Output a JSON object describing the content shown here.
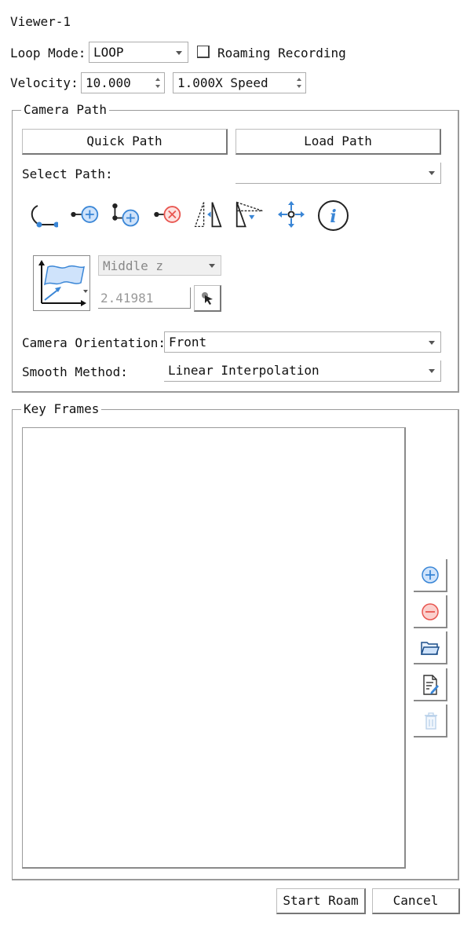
{
  "window": {
    "title": "Viewer-1"
  },
  "loop_mode": {
    "label": "Loop Mode:",
    "value": "LOOP"
  },
  "roaming_recording": {
    "label": "Roaming Recording",
    "checked": false
  },
  "velocity": {
    "label": "Velocity:",
    "value": "10.000",
    "speed": "1.000X Speed"
  },
  "camera_path": {
    "title": "Camera Path",
    "quick_path_label": "Quick Path",
    "load_path_label": "Load Path",
    "select_path_label": "Select Path:",
    "select_path_value": "",
    "toolbar_icons": [
      "curve-path-icon",
      "add-point-icon",
      "insert-point-icon",
      "delete-point-icon",
      "flip-icon",
      "view-frustum-icon",
      "move-icon",
      "info-icon"
    ],
    "plane_icon": "plane-axis-icon",
    "plane_axis_value": "Middle z",
    "plane_offset_value": "2.41981",
    "pick_icon": "pick-cursor-icon",
    "orientation_label": "Camera Orientation:",
    "orientation_value": "Front",
    "smooth_label": "Smooth Method:",
    "smooth_value": "Linear Interpolation"
  },
  "key_frames": {
    "title": "Key Frames",
    "items": [],
    "side_buttons": [
      "add-keyframe-icon",
      "remove-keyframe-icon",
      "open-folder-icon",
      "edit-file-icon",
      "delete-all-icon"
    ]
  },
  "footer": {
    "start_label": "Start Roam",
    "cancel_label": "Cancel"
  },
  "colors": {
    "accent": "#3a86d6",
    "danger": "#e8554f",
    "border": "#9a9a9a"
  }
}
